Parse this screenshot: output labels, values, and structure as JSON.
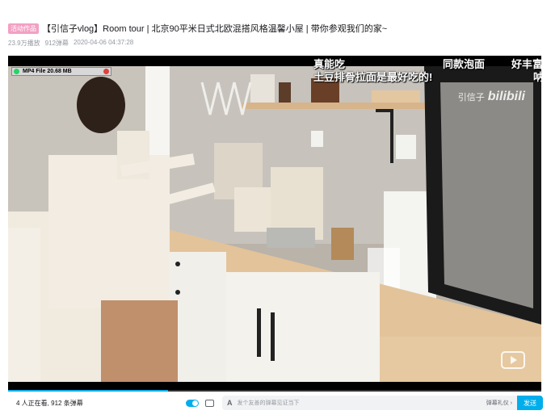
{
  "video": {
    "tag": "活动作品",
    "title": "【引信子vlog】Room tour | 北京90平米日式北欧混搭风格温馨小屋 | 带你参观我们的家~",
    "views": "23.9万播放",
    "danmaku_count": "912弹幕",
    "date": "2020-04-06 04:37:28"
  },
  "overlay": {
    "file_badge": "MP4 File 20.68 MB"
  },
  "danmaku": [
    "真能吃",
    "同款泡面",
    "好丰富",
    "土豆排骨拉面是最好吃的!",
    "呐"
  ],
  "watermark": {
    "author": "引信子",
    "logo": "bilibili"
  },
  "playback": {
    "progress_fraction": 0.3
  },
  "controls": {
    "viewers_text": "4 人正在看,",
    "danmaku_total": "912 条弹幕",
    "input_icon": "A",
    "input_placeholder": "发个友善的弹幕见证当下",
    "etiquette_label": "弹幕礼仪 ›",
    "send_label": "发送"
  },
  "icons": {
    "danmaku_toggle": "toggle-icon",
    "danmaku_settings": "danmaku-settings-icon",
    "tv": "bilibili-tv-icon",
    "whatsapp": "whatsapp-icon"
  },
  "colors": {
    "accent": "#00aeec",
    "tag_pink": "#f3a0c4"
  }
}
